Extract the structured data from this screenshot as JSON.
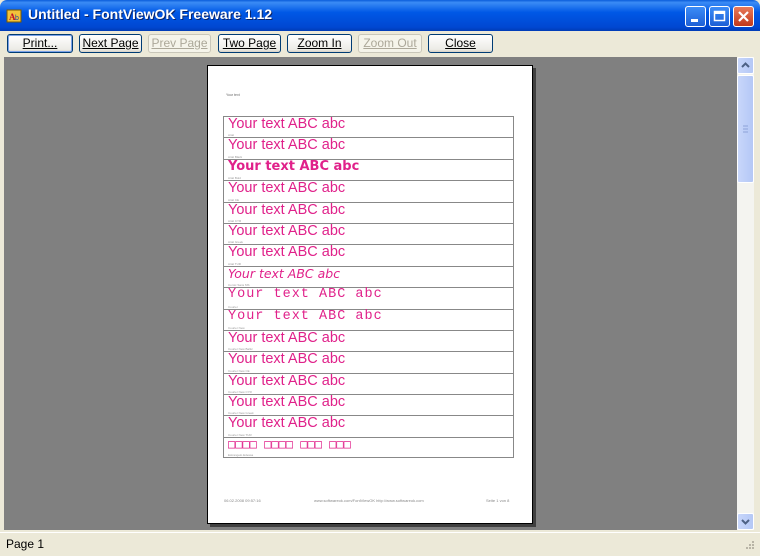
{
  "window": {
    "title": "Untitled - FontViewOK Freeware 1.12"
  },
  "toolbar": {
    "buttons": [
      {
        "label": "Print...",
        "enabled": true
      },
      {
        "label": "Next Page",
        "enabled": true
      },
      {
        "label": "Prev Page",
        "enabled": false
      },
      {
        "label": "Two Page",
        "enabled": true
      },
      {
        "label": "Zoom In",
        "enabled": true
      },
      {
        "label": "Zoom Out",
        "enabled": false
      },
      {
        "label": "Close",
        "enabled": true
      }
    ]
  },
  "preview": {
    "header_note": "Your text",
    "sample_color": "#E0218A",
    "rows": [
      {
        "sample": "Your text ABC abc",
        "caption": "Arial",
        "font": "sans"
      },
      {
        "sample": "Your text ABC abc",
        "caption": "Arial Black",
        "font": "sans"
      },
      {
        "sample": "Your text ABC abc",
        "caption": "Arial Bold",
        "font": "sans-bold"
      },
      {
        "sample": "Your text ABC abc",
        "caption": "Arial CE",
        "font": "sans"
      },
      {
        "sample": "Your text ABC abc",
        "caption": "Arial CYR",
        "font": "sans"
      },
      {
        "sample": "Your text ABC abc",
        "caption": "Arial Greek",
        "font": "sans"
      },
      {
        "sample": "Your text ABC abc",
        "caption": "Arial TUR",
        "font": "sans"
      },
      {
        "sample": "Your text ABC abc",
        "caption": "Comic Sans MS",
        "font": "sans-italic"
      },
      {
        "sample": "Your text ABC abc",
        "caption": "Courier",
        "font": "mono"
      },
      {
        "sample": "Your text ABC abc",
        "caption": "Courier New",
        "font": "mono"
      },
      {
        "sample": "Your text ABC abc",
        "caption": "Courier New Baltic",
        "font": "sans"
      },
      {
        "sample": "Your text ABC abc",
        "caption": "Courier New CE",
        "font": "sans"
      },
      {
        "sample": "Your text ABC abc",
        "caption": "Courier New CYR",
        "font": "sans"
      },
      {
        "sample": "Your text ABC abc",
        "caption": "Courier New Greek",
        "font": "sans"
      },
      {
        "sample": "Your text ABC abc",
        "caption": "Courier New TUR",
        "font": "sans"
      },
      {
        "sample": "□□□□ □□□□ □□□ □□□",
        "caption": "Estrangelo Edessa",
        "font": "boxes"
      }
    ],
    "footer": {
      "left": "06.02.2008 09:57:16",
      "center": "www.softwareok.com/FontViewOK  http://www.softwareok.com",
      "right": "Seite 1 von 8"
    }
  },
  "statusbar": {
    "text": "Page 1"
  },
  "colors": {
    "title_bar": "#0058E6",
    "workspace": "#808080",
    "accent_text": "#E0218A"
  }
}
